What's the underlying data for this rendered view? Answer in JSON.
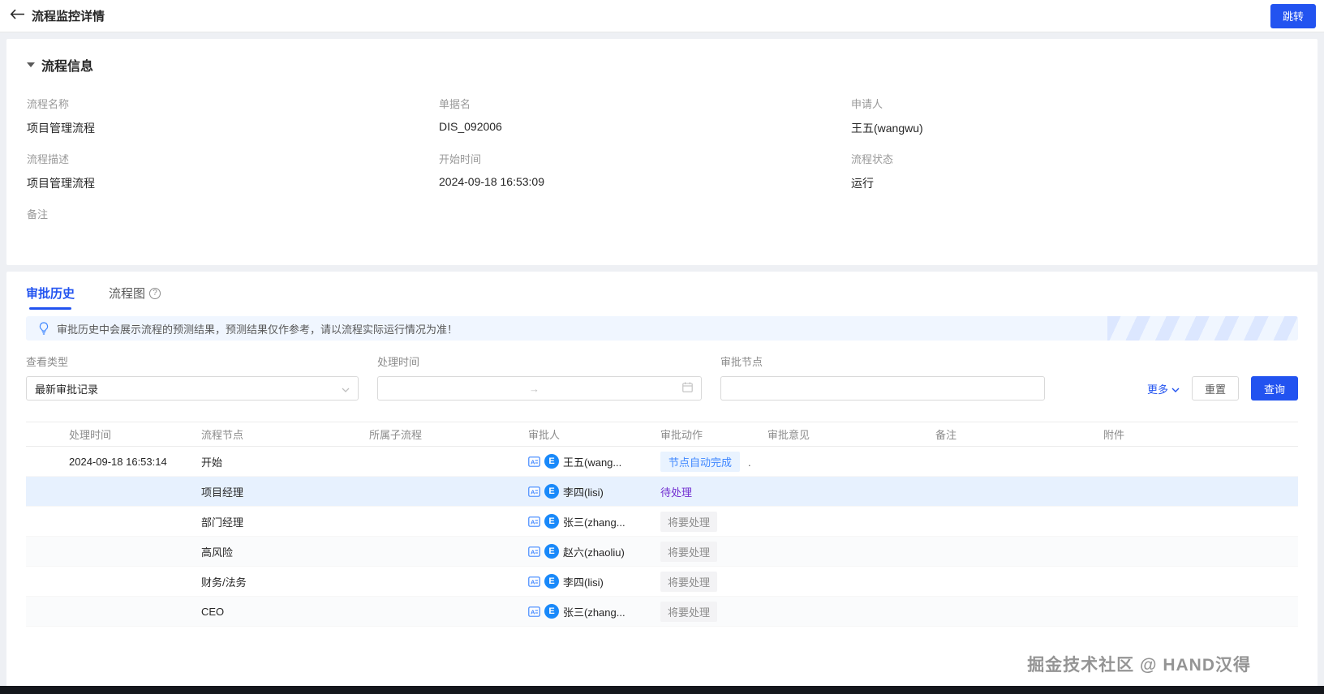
{
  "header": {
    "title": "流程监控详情",
    "jump_button": "跳转"
  },
  "process_info": {
    "section_title": "流程信息",
    "fields": [
      {
        "label": "流程名称",
        "value": "项目管理流程"
      },
      {
        "label": "单据名",
        "value": "DIS_092006"
      },
      {
        "label": "申请人",
        "value": "王五(wangwu)"
      },
      {
        "label": "流程描述",
        "value": "项目管理流程"
      },
      {
        "label": "开始时间",
        "value": "2024-09-18 16:53:09"
      },
      {
        "label": "流程状态",
        "value": "运行"
      },
      {
        "label": "备注",
        "value": ""
      }
    ]
  },
  "tabs": {
    "history": "审批历史",
    "diagram": "流程图",
    "diagram_help": "?"
  },
  "notice": "审批历史中会展示流程的预测结果，预测结果仅作参考，请以流程实际运行情况为准！",
  "filters": {
    "view_type_label": "查看类型",
    "view_type_value": "最新审批记录",
    "process_time_label": "处理时间",
    "range_separator": "→",
    "approve_node_label": "审批节点",
    "approve_node_value": "",
    "more_label": "更多",
    "reset_label": "重置",
    "query_label": "查询"
  },
  "table": {
    "columns": [
      "处理时间",
      "流程节点",
      "所属子流程",
      "审批人",
      "审批动作",
      "审批意见",
      "备注",
      "附件"
    ],
    "rows": [
      {
        "time": "2024-09-18 16:53:14",
        "node": "开始",
        "sub": "",
        "avatar": "E",
        "approver": "王五(wang...",
        "action": "节点自动完成",
        "action_type": "auto",
        "action_suffix": ".",
        "highlight": false
      },
      {
        "time": "",
        "node": "项目经理",
        "sub": "",
        "avatar": "E",
        "approver": "李四(lisi)",
        "action": "待处理",
        "action_type": "pending",
        "action_suffix": "",
        "highlight": true
      },
      {
        "time": "",
        "node": "部门经理",
        "sub": "",
        "avatar": "E",
        "approver": "张三(zhang...",
        "action": "将要处理",
        "action_type": "future",
        "action_suffix": "",
        "highlight": false
      },
      {
        "time": "",
        "node": "高风险",
        "sub": "",
        "avatar": "E",
        "approver": "赵六(zhaoliu)",
        "action": "将要处理",
        "action_type": "future",
        "action_suffix": "",
        "highlight": false
      },
      {
        "time": "",
        "node": "财务/法务",
        "sub": "",
        "avatar": "E",
        "approver": "李四(lisi)",
        "action": "将要处理",
        "action_type": "future",
        "action_suffix": "",
        "highlight": false
      },
      {
        "time": "",
        "node": "CEO",
        "sub": "",
        "avatar": "E",
        "approver": "张三(zhang...",
        "action": "将要处理",
        "action_type": "future",
        "action_suffix": "",
        "highlight": false
      }
    ]
  },
  "watermark": "掘金技术社区 @ HAND汉得",
  "colors": {
    "primary": "#2253f0",
    "link_blue": "#3f87ff",
    "pending_purple": "#722ed1",
    "future_gray": "#8c8c8c",
    "highlight_row": "#e7f1fe",
    "avatar_bg": "#1989fa",
    "banner_bg": "#f0f6ff",
    "auto_tag_bg": "#e9f3ff"
  }
}
